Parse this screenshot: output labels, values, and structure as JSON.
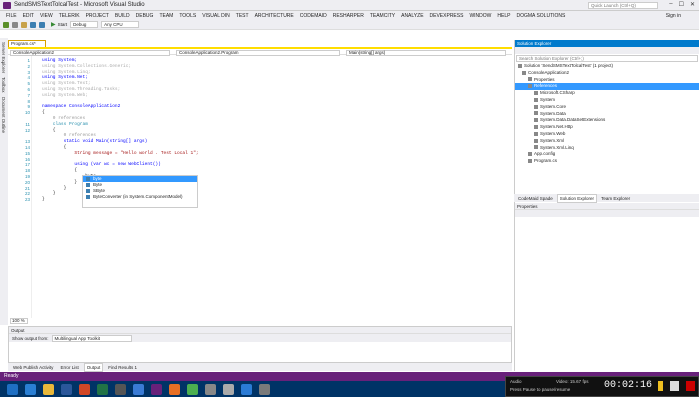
{
  "window": {
    "title": "SendSMSTextTolcalTest - Microsoft Visual Studio",
    "quick_launch": "Quick Launch (Ctrl+Q)",
    "sign_in": "Sign in"
  },
  "menu": [
    "FILE",
    "EDIT",
    "VIEW",
    "TELERIK",
    "PROJECT",
    "BUILD",
    "DEBUG",
    "TEAM",
    "TOOLS",
    "VISUAL DIN",
    "TEST",
    "ARCHITECTURE",
    "CODEMAID",
    "RESHARPER",
    "TEAMCITY",
    "ANALYZE",
    "DEVEXPRESS",
    "WINDOW",
    "HELP",
    "DOGMA SOLUTIONS"
  ],
  "toolbar": {
    "start": "Start",
    "config": "Debug",
    "platform": "Any CPU"
  },
  "left_tabs": [
    "Server Explorer",
    "Toolbox",
    "Document Outline"
  ],
  "doc_tab": "Program.cs*",
  "navbar": {
    "project": "ConsoleApplication2",
    "class": "ConsoleApplication2.Program",
    "member": "Main(string[] args)"
  },
  "code_lines": [
    {
      "n": "1",
      "t": "using System;",
      "c": "kw"
    },
    {
      "n": "2",
      "t": "using System.Collections.Generic;",
      "c": "gr"
    },
    {
      "n": "3",
      "t": "using System.Linq;",
      "c": "gr"
    },
    {
      "n": "4",
      "t": "using System.Net;",
      "c": "kw"
    },
    {
      "n": "5",
      "t": "using System.Text;",
      "c": "gr"
    },
    {
      "n": "6",
      "t": "using System.Threading.Tasks;",
      "c": "gr"
    },
    {
      "n": "7",
      "t": "using System.Web;",
      "c": "gr"
    },
    {
      "n": "8",
      "t": "",
      "c": ""
    },
    {
      "n": "9",
      "t": "namespace ConsoleApplication2",
      "c": "kw"
    },
    {
      "n": "10",
      "t": "{",
      "c": ""
    },
    {
      "n": "",
      "t": "    0 references",
      "c": "cm"
    },
    {
      "n": "11",
      "t": "    class Program",
      "c": "ty"
    },
    {
      "n": "12",
      "t": "    {",
      "c": ""
    },
    {
      "n": "",
      "t": "        0 references",
      "c": "cm"
    },
    {
      "n": "13",
      "t": "        static void Main(string[] args)",
      "c": "kw"
    },
    {
      "n": "14",
      "t": "        {",
      "c": ""
    },
    {
      "n": "15",
      "t": "            String message = \"Hello world . Test Local 1\";",
      "c": "st"
    },
    {
      "n": "16",
      "t": "",
      "c": ""
    },
    {
      "n": "17",
      "t": "            using (var wc = new WebClient())",
      "c": "kw"
    },
    {
      "n": "18",
      "t": "            {",
      "c": ""
    },
    {
      "n": "19",
      "t": "                byte",
      "c": ""
    },
    {
      "n": "20",
      "t": "            }",
      "c": ""
    },
    {
      "n": "21",
      "t": "        }",
      "c": ""
    },
    {
      "n": "22",
      "t": "    }",
      "c": ""
    },
    {
      "n": "23",
      "t": "}",
      "c": ""
    }
  ],
  "intellisense": [
    "byte",
    "Byte",
    "SByte",
    "ByteConverter (in System.ComponentModel)"
  ],
  "zoom": "100 %",
  "output": {
    "title": "Output",
    "show_from": "Show output from:",
    "source": "Multilingual App Toolkit"
  },
  "bottom_tabs": [
    "Web Publish Activity",
    "Error List",
    "Output",
    "Find Results 1"
  ],
  "status": "Ready",
  "solution_explorer": {
    "title": "Solution Explorer",
    "search": "Search Solution Explorer (Ctrl+;)",
    "nodes": [
      "Solution 'SendSMSTextTolcalTest' (1 project)",
      "ConsoleApplication2",
      "Properties",
      "References",
      "Microsoft.CSharp",
      "System",
      "System.Core",
      "System.Data",
      "System.Data.DataSetExtensions",
      "System.Net.Http",
      "System.Web",
      "System.Xml",
      "System.Xml.Linq",
      "App.config",
      "Program.cs"
    ]
  },
  "se_tabs": [
    "CodeMaid Spade",
    "Solution Explorer",
    "Team Explorer"
  ],
  "properties": {
    "title": "Properties"
  },
  "recorder": {
    "time": "00:02:16",
    "audio": "Audio",
    "video": "Video: 15.67 fps",
    "hint": "Press Pause to pause/resume"
  },
  "colors": {
    "accent": "#68217a",
    "blue": "#007acc"
  }
}
